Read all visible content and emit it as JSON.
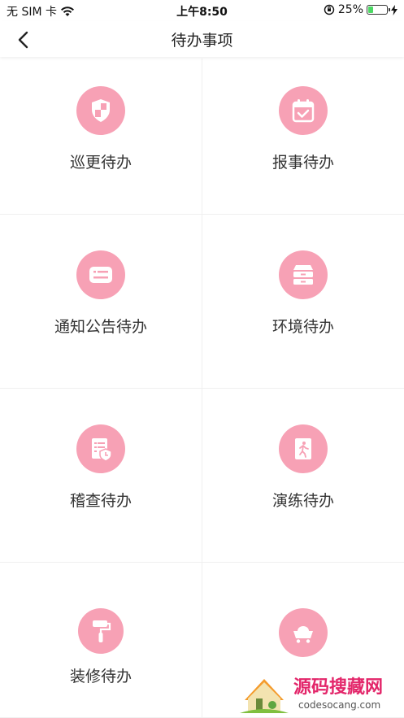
{
  "status_bar": {
    "carrier": "无 SIM 卡",
    "time": "上午8:50",
    "battery": "25%",
    "battery_level": 0.25
  },
  "nav": {
    "title": "待办事项"
  },
  "items": [
    {
      "label": "巡更待办",
      "icon": "shield-icon"
    },
    {
      "label": "报事待办",
      "icon": "calendar-check-icon"
    },
    {
      "label": "通知公告待办",
      "icon": "notice-icon"
    },
    {
      "label": "环境待办",
      "icon": "drawer-icon"
    },
    {
      "label": "稽查待办",
      "icon": "audit-doc-icon"
    },
    {
      "label": "演练待办",
      "icon": "exit-door-icon"
    },
    {
      "label": "装修待办",
      "icon": "paint-roller-icon"
    },
    {
      "label": "",
      "icon": "cart-icon"
    }
  ],
  "watermark": {
    "text": "源码搜藏网",
    "url": "codesocang.com"
  },
  "colors": {
    "accent": "#f7a1b5",
    "battery_fill": "#4cd964"
  }
}
